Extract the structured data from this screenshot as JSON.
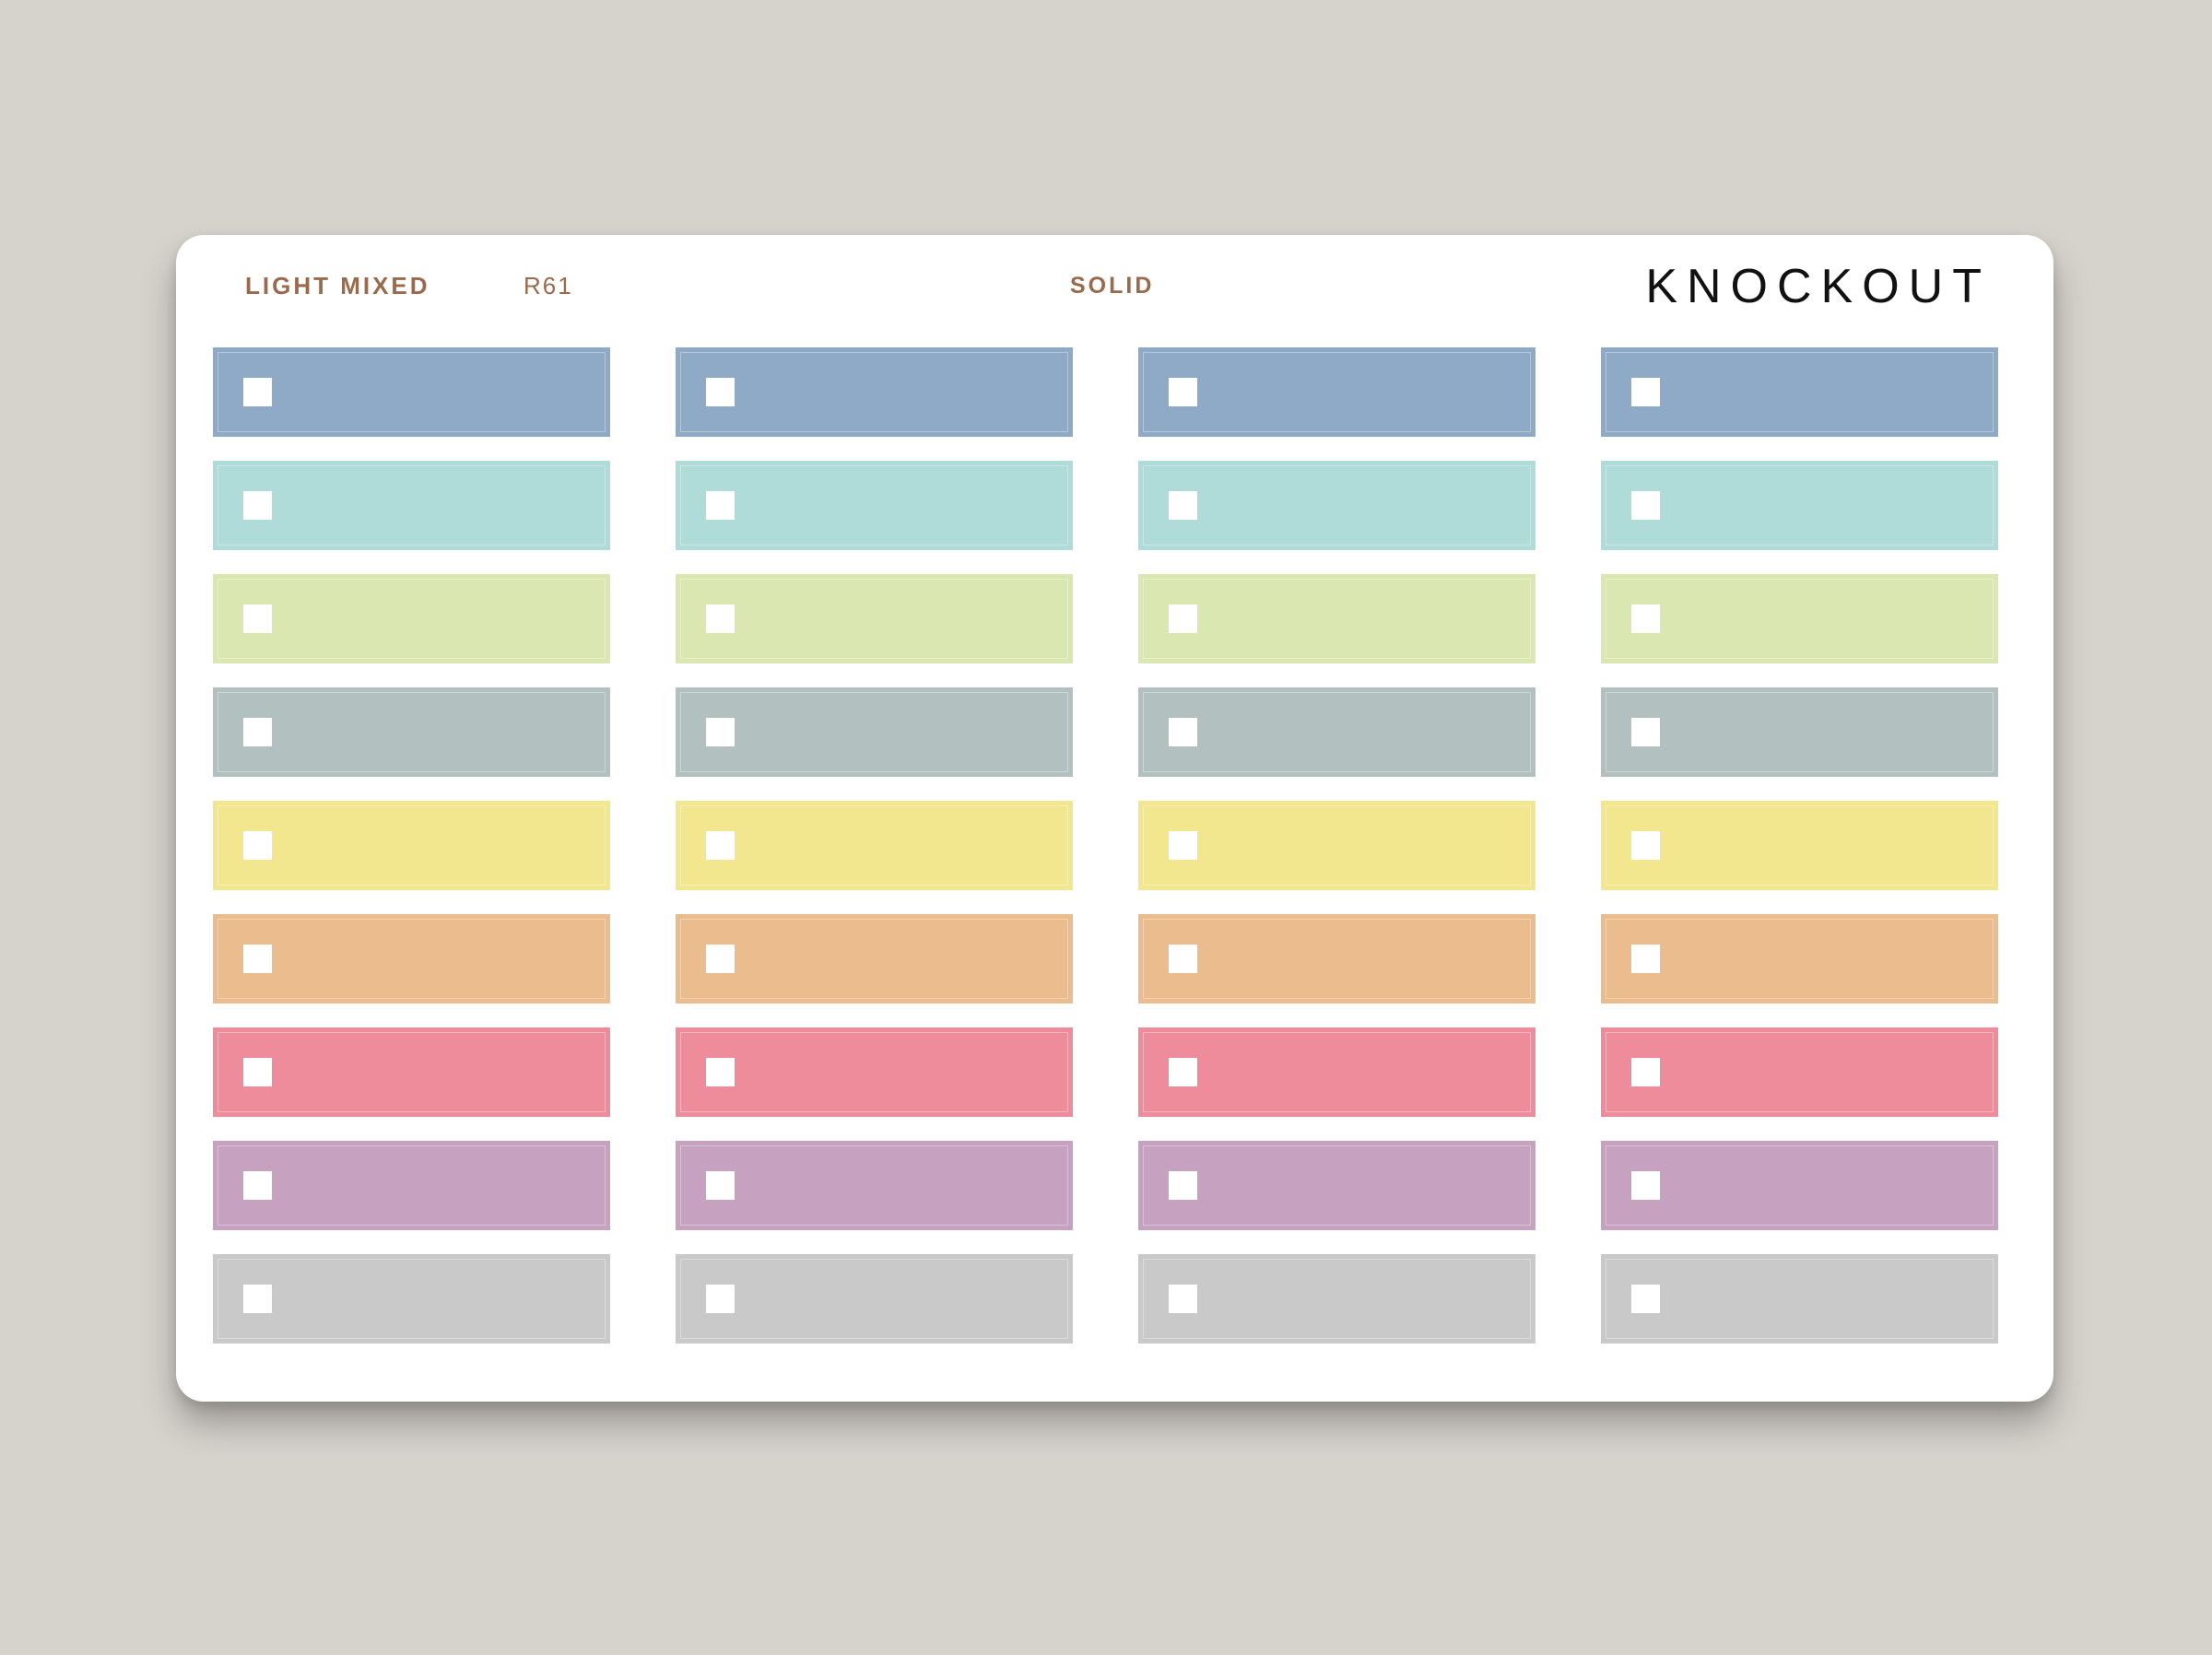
{
  "sheet": {
    "variant": "LIGHT MIXED",
    "code": "R61",
    "style": "SOLID",
    "brand": "KNOCKOUT"
  },
  "columns": 4,
  "row_colors": [
    "#8eaac7",
    "#afdbd8",
    "#dae7b0",
    "#b2c0c0",
    "#f2e68f",
    "#ebbc8e",
    "#ee8c9c",
    "#c6a2c0",
    "#c9c9c9"
  ],
  "sticker_icon": "checkbox-square-icon"
}
